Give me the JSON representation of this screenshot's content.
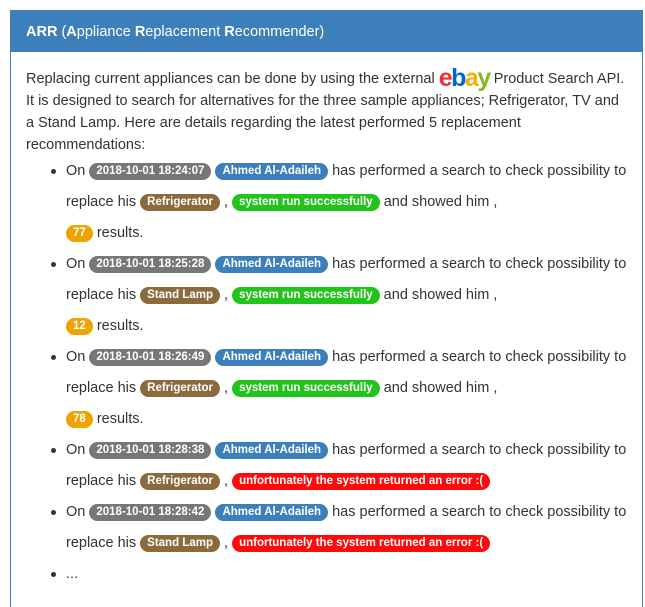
{
  "header": {
    "abbr": "ARR",
    "open_paren": " (",
    "w1_first": "A",
    "w1_rest": "ppliance ",
    "w2_first": "R",
    "w2_rest": "eplacement ",
    "w3_first": "R",
    "w3_rest": "ecommender",
    "close_paren": ")"
  },
  "intro": {
    "text_before_logo": "Replacing current appliances can be done by using the external ",
    "logo": {
      "e": "e",
      "b": "b",
      "a": "a",
      "y": "y"
    },
    "text_after_logo": " Product Search API. It is designed to search for alternatives for the three sample appliances; Refrigerator, TV and a Stand Lamp. Here are details regarding the latest performed 5 replacement recommendations:"
  },
  "phrases": {
    "on": "On ",
    "performed": " has performed a search to check possibility to replace his ",
    "comma": " , ",
    "showed": " and showed him ,",
    "results": " results."
  },
  "recommendations": [
    {
      "timestamp": "2018-10-01 18:24:07",
      "user": "Ahmed Al-Adaileh",
      "appliance": "Refrigerator",
      "status": "system run successfully",
      "results": "77"
    },
    {
      "timestamp": "2018-10-01 18:25:28",
      "user": "Ahmed Al-Adaileh",
      "appliance": "Stand Lamp",
      "status": "system run successfully",
      "results": "12"
    },
    {
      "timestamp": "2018-10-01 18:26:49",
      "user": "Ahmed Al-Adaileh",
      "appliance": "Refrigerator",
      "status": "system run successfully",
      "results": "78"
    },
    {
      "timestamp": "2018-10-01 18:28:38",
      "user": "Ahmed Al-Adaileh",
      "appliance": "Refrigerator",
      "status": "unfortunately the system returned an error :("
    },
    {
      "timestamp": "2018-10-01 18:28:42",
      "user": "Ahmed Al-Adaileh",
      "appliance": "Stand Lamp",
      "status": "unfortunately the system returned an error :("
    }
  ],
  "more": "...",
  "colors": {
    "primary": "#3c7fba",
    "timestamp_badge": "#777777",
    "appliance_badge": "#8b6b3d",
    "success_badge": "#22c41b",
    "error_badge": "#ff0a0a",
    "count_badge": "#f0a200"
  }
}
